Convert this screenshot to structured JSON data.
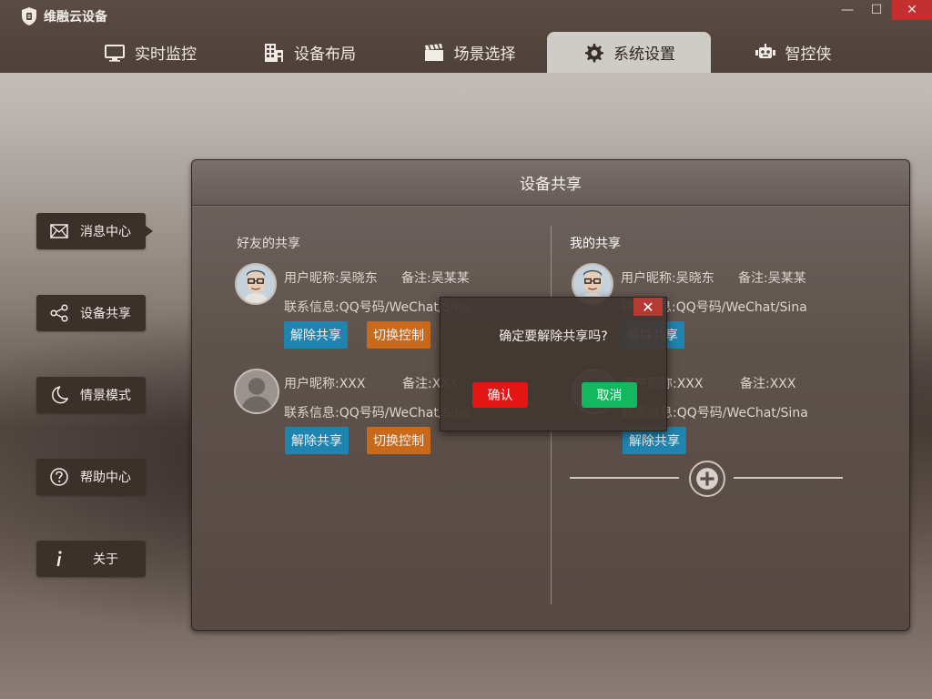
{
  "app": {
    "title": "维融云设备"
  },
  "window": {
    "minimize": "—",
    "restore": "☐",
    "close": "✕"
  },
  "nav": [
    {
      "label": "实时监控",
      "icon": "monitor-icon"
    },
    {
      "label": "设备布局",
      "icon": "building-icon"
    },
    {
      "label": "场景选择",
      "icon": "clapperboard-icon"
    },
    {
      "label": "系统设置",
      "icon": "gear-icon",
      "active": true
    },
    {
      "label": "智控侠",
      "icon": "robot-icon"
    }
  ],
  "sidebar": [
    {
      "label": "消息中心",
      "icon": "mail-icon",
      "active": true
    },
    {
      "label": "设备共享",
      "icon": "share-icon"
    },
    {
      "label": "情景模式",
      "icon": "moon-icon"
    },
    {
      "label": "帮助中心",
      "icon": "help-icon"
    },
    {
      "label": "关于",
      "icon": "info-icon"
    }
  ],
  "panel": {
    "title": "设备共享",
    "friends": {
      "title": "好友的共享",
      "entries": [
        {
          "nick": "用户昵称:吴晓东",
          "remark": "备注:吴某某",
          "contact": "联系信息:QQ号码/WeChat/Sina",
          "btn1": "解除共享",
          "btn2": "切换控制",
          "avatar": "cartoon"
        },
        {
          "nick": "用户昵称:XXX",
          "remark": "备注:XXX",
          "contact": "联系信息:QQ号码/WeChat/Sina",
          "btn1": "解除共享",
          "btn2": "切换控制",
          "avatar": "default"
        }
      ]
    },
    "mine": {
      "title": "我的共享",
      "entries": [
        {
          "nick": "用户昵称:吴晓东",
          "remark": "备注:吴某某",
          "contact": "联系信息:QQ号码/WeChat/Sina",
          "btn1": "解除共享",
          "avatar": "cartoon"
        },
        {
          "nick": "用户昵称:XXX",
          "remark": "备注:XXX",
          "contact": "联系信息:QQ号码/WeChat/Sina",
          "btn1": "解除共享",
          "avatar": "default"
        }
      ]
    }
  },
  "dialog": {
    "message": "确定要解除共享吗?",
    "confirm": "确认",
    "cancel": "取消",
    "close": "✕"
  }
}
